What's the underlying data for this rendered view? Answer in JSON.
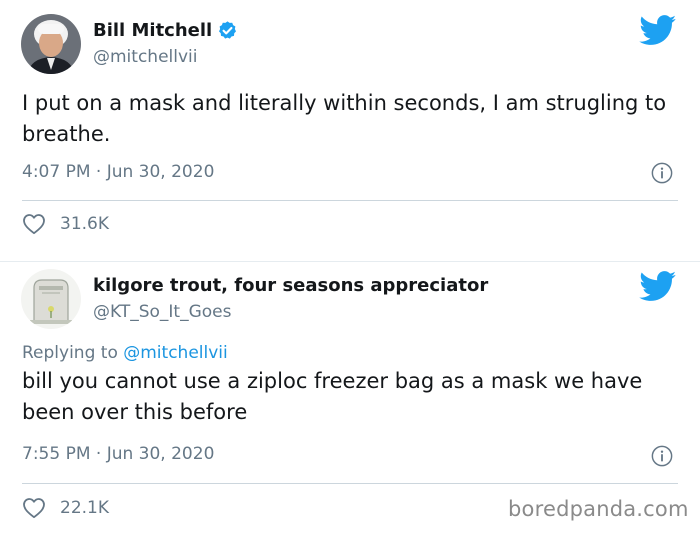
{
  "tweets": [
    {
      "author": {
        "name": "Bill Mitchell",
        "handle": "@mitchellvii",
        "verified": true
      },
      "text": "I put on a mask and literally within seconds, I am strugling to breathe.",
      "timestamp": "4:07 PM · Jun 30, 2020",
      "likes": "31.6K"
    },
    {
      "author": {
        "name": "kilgore trout, four seasons appreciator",
        "handle": "@KT_So_It_Goes",
        "verified": false
      },
      "replying_prefix": "Replying to ",
      "replying_to": "@mitchellvii",
      "text": "bill you cannot use a ziploc freezer bag as a mask we have been over this before",
      "timestamp": "7:55 PM · Jun 30, 2020",
      "likes": "22.1K"
    }
  ],
  "watermark": "boredpanda.com",
  "colors": {
    "twitter_blue": "#1da1f2",
    "link_blue": "#1b95e0",
    "muted_gray": "#657786"
  },
  "icons": [
    "verified-badge-icon",
    "twitter-bird-icon",
    "info-icon",
    "heart-icon"
  ]
}
